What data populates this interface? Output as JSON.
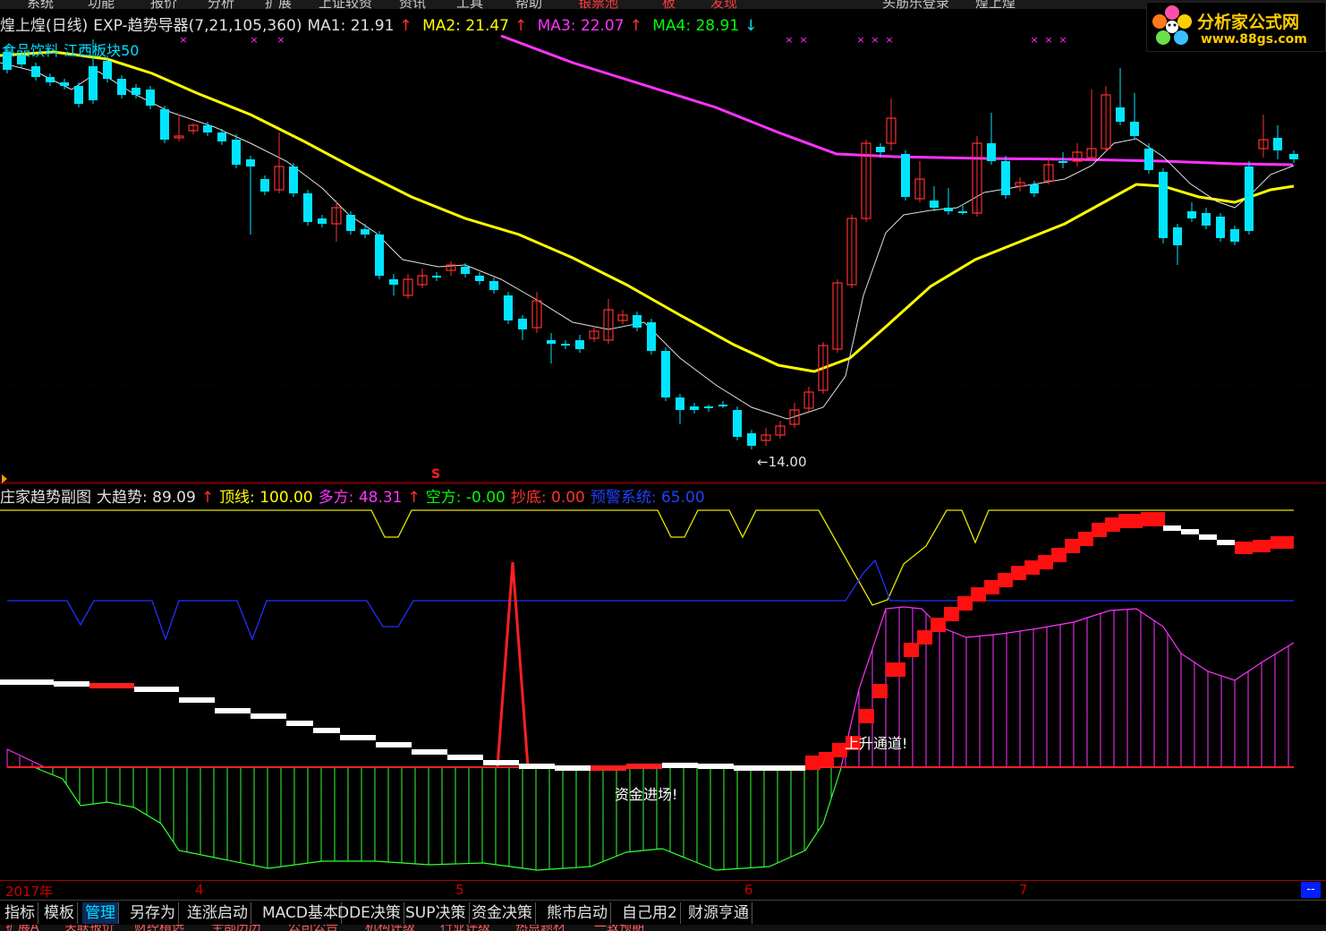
{
  "menu": {
    "items": [
      "系统",
      "功能",
      "报价",
      "分析",
      "扩展",
      "上证较资",
      "资讯",
      "工具",
      "帮助",
      "银票池",
      "板",
      "发现",
      "头筋乐登录",
      "煌上煌"
    ],
    "highlight_color": "#ff3a3a"
  },
  "logo": {
    "text": "分析家公式网",
    "url": "www.88gs.com"
  },
  "main_panel": {
    "title": "煌上煌(日线)",
    "indicator": "EXP-趋势导器(7,21,105,360)",
    "ma": [
      {
        "label": "MA1: 21.91",
        "arrow": "↑",
        "color": "#e0e0e0"
      },
      {
        "label": "MA2: 21.47",
        "arrow": "↑",
        "color": "#ffff00"
      },
      {
        "label": "MA3: 22.07",
        "arrow": "↑",
        "color": "#ff33ff"
      },
      {
        "label": "MA4: 28.91",
        "arrow": "↓",
        "color": "#00ff00"
      }
    ],
    "sector": "食品饮料 江西板块50",
    "low_marker": "←14.00",
    "colors": {
      "ma1": "#e0e0e0",
      "ma2": "#ffff00",
      "ma3": "#ff33ff",
      "up": "#ff3030",
      "down": "#00e5ff"
    }
  },
  "sub_panel": {
    "title": "庄家趋势副图",
    "fields": [
      {
        "label": "大趋势: 89.09",
        "arrow": "↑",
        "color": "#e0e0e0"
      },
      {
        "label": "顶线: 100.00",
        "arrow": "",
        "color": "#ffff00"
      },
      {
        "label": "多方: 48.31",
        "arrow": "↑",
        "color": "#ff33ff"
      },
      {
        "label": "空方: -0.00",
        "arrow": "",
        "color": "#00ff00"
      },
      {
        "label": "抄底: 0.00",
        "arrow": "",
        "color": "#ff3030"
      },
      {
        "label": "预警系统: 65.00",
        "arrow": "",
        "color": "#2040ff"
      }
    ],
    "annotation_up": "上升通道!",
    "annotation_fund": "资金进场!",
    "signal_mark": "S"
  },
  "time_axis": {
    "labels": [
      "2017年",
      "4",
      "5",
      "6",
      "7"
    ]
  },
  "tabs": {
    "items": [
      "指标",
      "模板",
      "管理",
      "另存为",
      "连涨启动",
      "MACD基本",
      "DDE决策",
      "SUP决策",
      "资金决策",
      "熊市启动",
      "自己用2",
      "财源亨通"
    ],
    "active": 2
  },
  "bottom_bar": {
    "items": [
      "扩展A",
      "关联报价",
      "财经精选",
      "全部历历",
      "公司公告",
      "机构评级",
      "行业评级",
      "热点题材",
      "一致预期"
    ]
  }
}
